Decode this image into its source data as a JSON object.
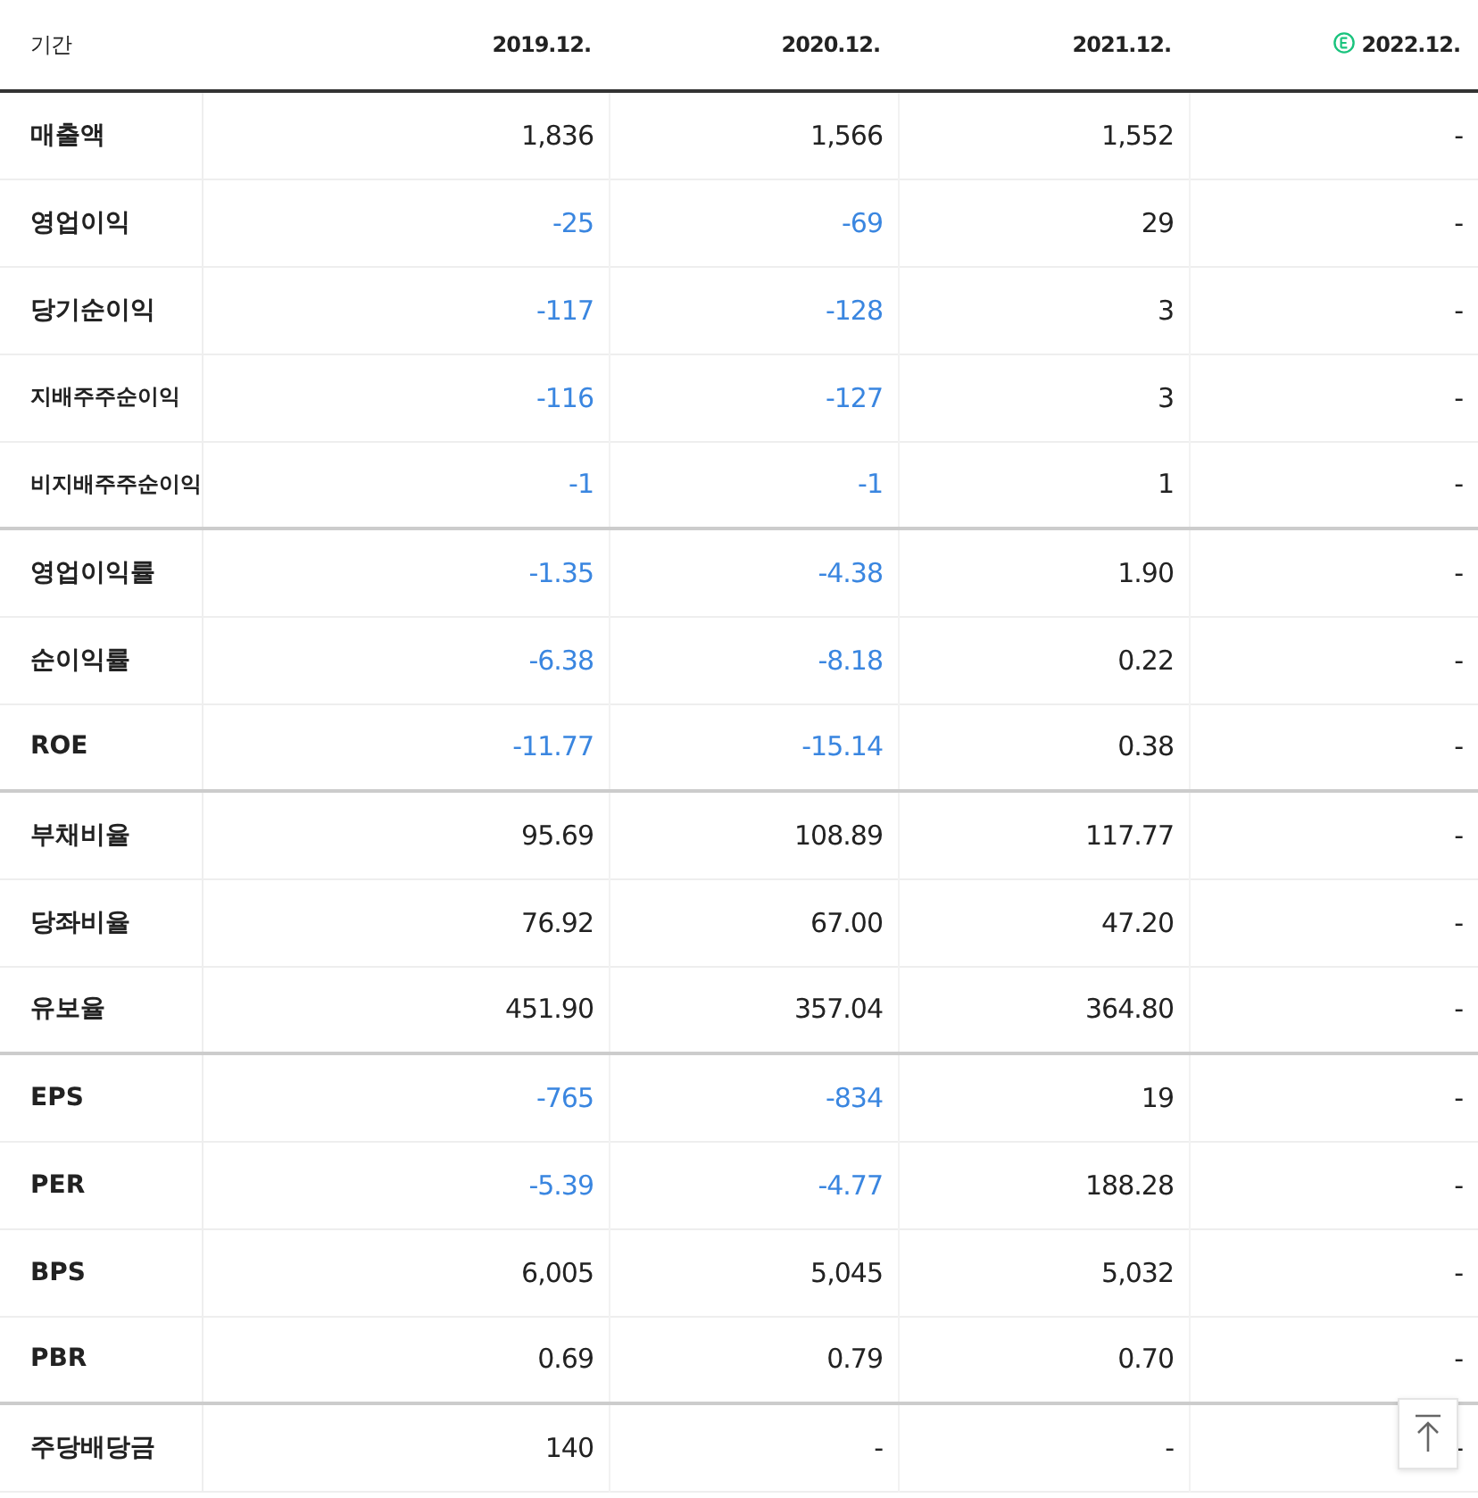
{
  "header": {
    "label": "기간",
    "columns": [
      {
        "title": "2019.12.",
        "estimate": false
      },
      {
        "title": "2020.12.",
        "estimate": false
      },
      {
        "title": "2021.12.",
        "estimate": false
      },
      {
        "title": "2022.12.",
        "estimate": true
      }
    ]
  },
  "groups": [
    {
      "rows": [
        {
          "label": "매출액",
          "small": false,
          "values": [
            "1,836",
            "1,566",
            "1,552",
            "-"
          ],
          "negative": [
            false,
            false,
            false,
            false
          ]
        },
        {
          "label": "영업이익",
          "small": false,
          "values": [
            "-25",
            "-69",
            "29",
            "-"
          ],
          "negative": [
            true,
            true,
            false,
            false
          ]
        },
        {
          "label": "당기순이익",
          "small": false,
          "values": [
            "-117",
            "-128",
            "3",
            "-"
          ],
          "negative": [
            true,
            true,
            false,
            false
          ]
        },
        {
          "label": "지배주주순이익",
          "small": true,
          "values": [
            "-116",
            "-127",
            "3",
            "-"
          ],
          "negative": [
            true,
            true,
            false,
            false
          ]
        },
        {
          "label": "비지배주주순이익",
          "small": true,
          "values": [
            "-1",
            "-1",
            "1",
            "-"
          ],
          "negative": [
            true,
            true,
            false,
            false
          ]
        }
      ]
    },
    {
      "rows": [
        {
          "label": "영업이익률",
          "small": false,
          "values": [
            "-1.35",
            "-4.38",
            "1.90",
            "-"
          ],
          "negative": [
            true,
            true,
            false,
            false
          ]
        },
        {
          "label": "순이익률",
          "small": false,
          "values": [
            "-6.38",
            "-8.18",
            "0.22",
            "-"
          ],
          "negative": [
            true,
            true,
            false,
            false
          ]
        },
        {
          "label": "ROE",
          "small": false,
          "values": [
            "-11.77",
            "-15.14",
            "0.38",
            "-"
          ],
          "negative": [
            true,
            true,
            false,
            false
          ]
        }
      ]
    },
    {
      "rows": [
        {
          "label": "부채비율",
          "small": false,
          "values": [
            "95.69",
            "108.89",
            "117.77",
            "-"
          ],
          "negative": [
            false,
            false,
            false,
            false
          ]
        },
        {
          "label": "당좌비율",
          "small": false,
          "values": [
            "76.92",
            "67.00",
            "47.20",
            "-"
          ],
          "negative": [
            false,
            false,
            false,
            false
          ]
        },
        {
          "label": "유보율",
          "small": false,
          "values": [
            "451.90",
            "357.04",
            "364.80",
            "-"
          ],
          "negative": [
            false,
            false,
            false,
            false
          ]
        }
      ]
    },
    {
      "rows": [
        {
          "label": "EPS",
          "small": false,
          "values": [
            "-765",
            "-834",
            "19",
            "-"
          ],
          "negative": [
            true,
            true,
            false,
            false
          ]
        },
        {
          "label": "PER",
          "small": false,
          "values": [
            "-5.39",
            "-4.77",
            "188.28",
            "-"
          ],
          "negative": [
            true,
            true,
            false,
            false
          ]
        },
        {
          "label": "BPS",
          "small": false,
          "values": [
            "6,005",
            "5,045",
            "5,032",
            "-"
          ],
          "negative": [
            false,
            false,
            false,
            false
          ]
        },
        {
          "label": "PBR",
          "small": false,
          "values": [
            "0.69",
            "0.79",
            "0.70",
            "-"
          ],
          "negative": [
            false,
            false,
            false,
            false
          ]
        }
      ]
    },
    {
      "rows": [
        {
          "label": "주당배당금",
          "small": false,
          "values": [
            "140",
            "-",
            "-",
            "-"
          ],
          "negative": [
            false,
            false,
            false,
            false
          ]
        }
      ]
    }
  ]
}
